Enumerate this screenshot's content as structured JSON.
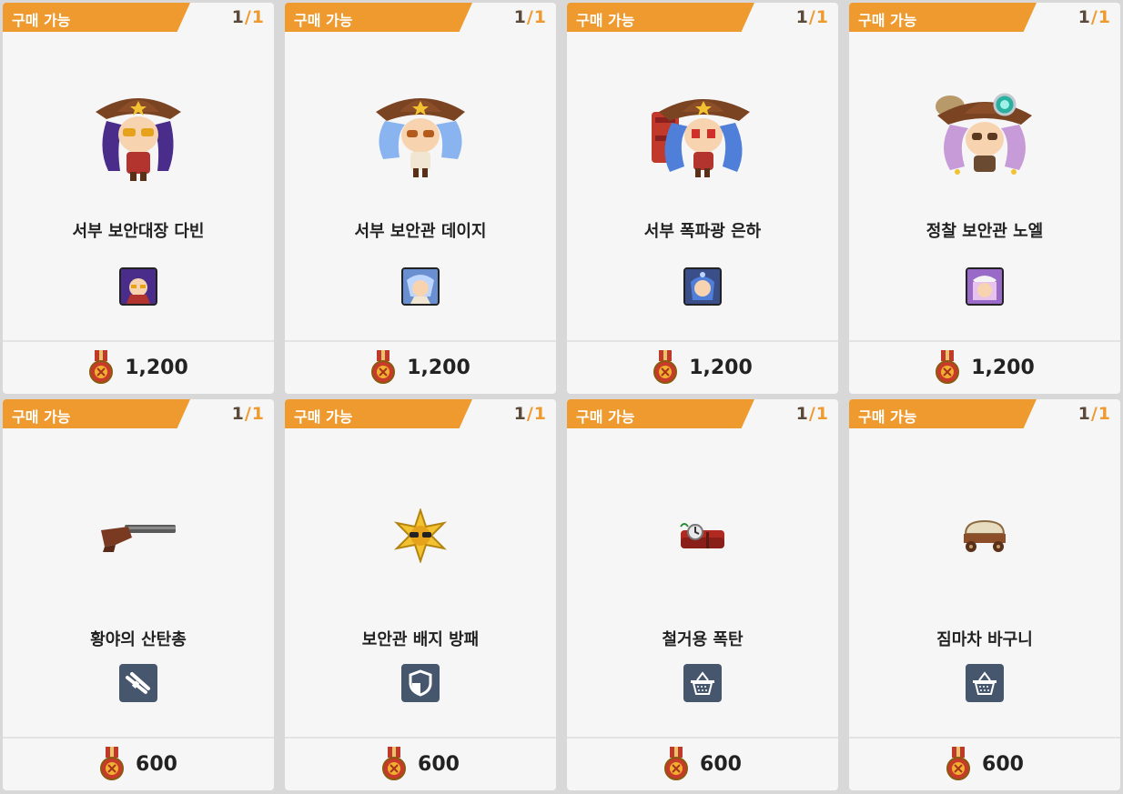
{
  "cards": [
    {
      "status": "구매 가능",
      "count": "1",
      "max": "1",
      "name": "서부 보안대장 다빈",
      "price": "1,200",
      "kind": "character",
      "type_icon": "portrait-icon",
      "hair": "#4a2d8a"
    },
    {
      "status": "구매 가능",
      "count": "1",
      "max": "1",
      "name": "서부 보안관 데이지",
      "price": "1,200",
      "kind": "character",
      "type_icon": "portrait-icon",
      "hair": "#8ab4f0"
    },
    {
      "status": "구매 가능",
      "count": "1",
      "max": "1",
      "name": "서부 폭파광 은하",
      "price": "1,200",
      "kind": "character",
      "type_icon": "portrait-icon",
      "hair": "#4f7fd8"
    },
    {
      "status": "구매 가능",
      "count": "1",
      "max": "1",
      "name": "정찰 보안관 노엘",
      "price": "1,200",
      "kind": "character",
      "type_icon": "portrait-icon",
      "hair": "#c79ad8"
    },
    {
      "status": "구매 가능",
      "count": "1",
      "max": "1",
      "name": "황야의 산탄총",
      "price": "600",
      "kind": "weapon",
      "type_icon": "gun-icon"
    },
    {
      "status": "구매 가능",
      "count": "1",
      "max": "1",
      "name": "보안관 배지 방패",
      "price": "600",
      "kind": "shield",
      "type_icon": "shield-icon"
    },
    {
      "status": "구매 가능",
      "count": "1",
      "max": "1",
      "name": "철거용 폭탄",
      "price": "600",
      "kind": "bomb",
      "type_icon": "basket-icon"
    },
    {
      "status": "구매 가능",
      "count": "1",
      "max": "1",
      "name": "짐마차 바구니",
      "price": "600",
      "kind": "wagon",
      "type_icon": "basket-icon"
    }
  ],
  "currency_icon": "medal-icon",
  "colors": {
    "badge": "#ee9a2e",
    "count": "#5b4a3a",
    "category_icon_bg": "#45566d"
  }
}
